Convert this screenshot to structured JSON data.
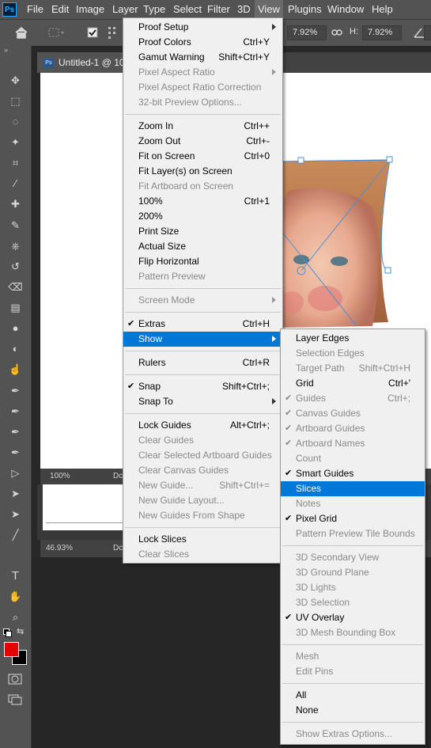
{
  "app": {
    "logo": "Ps"
  },
  "menubar": {
    "items": [
      "File",
      "Edit",
      "Image",
      "Layer",
      "Type",
      "Select",
      "Filter",
      "3D",
      "View",
      "Plugins",
      "Window",
      "Help"
    ],
    "active": "View"
  },
  "options_bar": {
    "w_value": "7.92%",
    "h_label": "H:",
    "h_value": "7.92%"
  },
  "document": {
    "tab_title": "Untitled-1 @ 10",
    "zoom_top": "100%",
    "status_top": "Dc",
    "zoom_bottom": "46.93%",
    "status_bottom": "Dc"
  },
  "view_menu": {
    "items": [
      {
        "label": "Proof Setup",
        "shortcut": "",
        "disabled": false,
        "submenu": true
      },
      {
        "label": "Proof Colors",
        "shortcut": "Ctrl+Y",
        "disabled": false
      },
      {
        "label": "Gamut Warning",
        "shortcut": "Shift+Ctrl+Y",
        "disabled": false
      },
      {
        "label": "Pixel Aspect Ratio",
        "shortcut": "",
        "disabled": true,
        "submenu": true
      },
      {
        "label": "Pixel Aspect Ratio Correction",
        "shortcut": "",
        "disabled": true
      },
      {
        "label": "32-bit Preview Options...",
        "shortcut": "",
        "disabled": true
      },
      {
        "sep": true
      },
      {
        "label": "Zoom In",
        "shortcut": "Ctrl++",
        "disabled": false
      },
      {
        "label": "Zoom Out",
        "shortcut": "Ctrl+-",
        "disabled": false
      },
      {
        "label": "Fit on Screen",
        "shortcut": "Ctrl+0",
        "disabled": false
      },
      {
        "label": "Fit Layer(s) on Screen",
        "shortcut": "",
        "disabled": false
      },
      {
        "label": "Fit Artboard on Screen",
        "shortcut": "",
        "disabled": true
      },
      {
        "label": "100%",
        "shortcut": "Ctrl+1",
        "disabled": false
      },
      {
        "label": "200%",
        "shortcut": "",
        "disabled": false
      },
      {
        "label": "Print Size",
        "shortcut": "",
        "disabled": false
      },
      {
        "label": "Actual Size",
        "shortcut": "",
        "disabled": false
      },
      {
        "label": "Flip Horizontal",
        "shortcut": "",
        "disabled": false
      },
      {
        "label": "Pattern Preview",
        "shortcut": "",
        "disabled": true
      },
      {
        "sep": true
      },
      {
        "label": "Screen Mode",
        "shortcut": "",
        "disabled": true,
        "submenu": true
      },
      {
        "sep": true
      },
      {
        "label": "Extras",
        "shortcut": "Ctrl+H",
        "disabled": false,
        "checked": true
      },
      {
        "label": "Show",
        "shortcut": "",
        "disabled": false,
        "submenu": true,
        "highlighted": true
      },
      {
        "sep": true
      },
      {
        "label": "Rulers",
        "shortcut": "Ctrl+R",
        "disabled": false
      },
      {
        "sep": true
      },
      {
        "label": "Snap",
        "shortcut": "Shift+Ctrl+;",
        "disabled": false,
        "checked": true
      },
      {
        "label": "Snap To",
        "shortcut": "",
        "disabled": false,
        "submenu": true
      },
      {
        "sep": true
      },
      {
        "label": "Lock Guides",
        "shortcut": "Alt+Ctrl+;",
        "disabled": false
      },
      {
        "label": "Clear Guides",
        "shortcut": "",
        "disabled": true
      },
      {
        "label": "Clear Selected Artboard Guides",
        "shortcut": "",
        "disabled": true
      },
      {
        "label": "Clear Canvas Guides",
        "shortcut": "",
        "disabled": true
      },
      {
        "label": "New Guide...",
        "shortcut": "Shift+Ctrl+=",
        "disabled": true
      },
      {
        "label": "New Guide Layout...",
        "shortcut": "",
        "disabled": true
      },
      {
        "label": "New Guides From Shape",
        "shortcut": "",
        "disabled": true
      },
      {
        "sep": true
      },
      {
        "label": "Lock Slices",
        "shortcut": "",
        "disabled": false
      },
      {
        "label": "Clear Slices",
        "shortcut": "",
        "disabled": true
      }
    ]
  },
  "show_submenu": {
    "items": [
      {
        "label": "Layer Edges",
        "shortcut": "",
        "disabled": false
      },
      {
        "label": "Selection Edges",
        "shortcut": "",
        "disabled": true
      },
      {
        "label": "Target Path",
        "shortcut": "Shift+Ctrl+H",
        "disabled": true
      },
      {
        "label": "Grid",
        "shortcut": "Ctrl+'",
        "disabled": false
      },
      {
        "label": "Guides",
        "shortcut": "Ctrl+;",
        "disabled": true,
        "checked": true
      },
      {
        "label": "Canvas Guides",
        "shortcut": "",
        "disabled": true,
        "checked": true
      },
      {
        "label": "Artboard Guides",
        "shortcut": "",
        "disabled": true,
        "checked": true
      },
      {
        "label": "Artboard Names",
        "shortcut": "",
        "disabled": true,
        "checked": true
      },
      {
        "label": "Count",
        "shortcut": "",
        "disabled": true
      },
      {
        "label": "Smart Guides",
        "shortcut": "",
        "disabled": false,
        "checked": true
      },
      {
        "label": "Slices",
        "shortcut": "",
        "disabled": false,
        "highlighted": true
      },
      {
        "label": "Notes",
        "shortcut": "",
        "disabled": true
      },
      {
        "label": "Pixel Grid",
        "shortcut": "",
        "disabled": false,
        "checked": true
      },
      {
        "label": "Pattern Preview Tile Bounds",
        "shortcut": "",
        "disabled": true
      },
      {
        "sep": true
      },
      {
        "label": "3D Secondary View",
        "shortcut": "",
        "disabled": true
      },
      {
        "label": "3D Ground Plane",
        "shortcut": "",
        "disabled": true
      },
      {
        "label": "3D Lights",
        "shortcut": "",
        "disabled": true
      },
      {
        "label": "3D Selection",
        "shortcut": "",
        "disabled": true
      },
      {
        "label": "UV Overlay",
        "shortcut": "",
        "disabled": false,
        "checked": true
      },
      {
        "label": "3D Mesh Bounding Box",
        "shortcut": "",
        "disabled": true
      },
      {
        "sep": true
      },
      {
        "label": "Mesh",
        "shortcut": "",
        "disabled": true
      },
      {
        "label": "Edit Pins",
        "shortcut": "",
        "disabled": true
      },
      {
        "sep": true
      },
      {
        "label": "All",
        "shortcut": "",
        "disabled": false
      },
      {
        "label": "None",
        "shortcut": "",
        "disabled": false
      },
      {
        "sep": true
      },
      {
        "label": "Show Extras Options...",
        "shortcut": "",
        "disabled": true
      }
    ]
  },
  "tools": [
    "move-icon",
    "marquee-icon",
    "lasso-icon",
    "magic-wand-icon",
    "crop-icon",
    "eyedropper-icon",
    "healing-brush-icon",
    "brush-icon",
    "clone-stamp-icon",
    "history-brush-icon",
    "eraser-icon",
    "gradient-icon",
    "blur-icon",
    "dodge-icon",
    "smudge-icon",
    "pen-icon",
    "freeform-pen-icon",
    "add-anchor-icon",
    "curvature-pen-icon",
    "convert-point-icon",
    "path-selection-icon",
    "direct-selection-icon",
    "line-icon",
    "type-icon",
    "hand-icon",
    "zoom-icon"
  ],
  "colors": {
    "foreground": "#e60000",
    "background": "#000000",
    "highlight": "#0078d7"
  }
}
